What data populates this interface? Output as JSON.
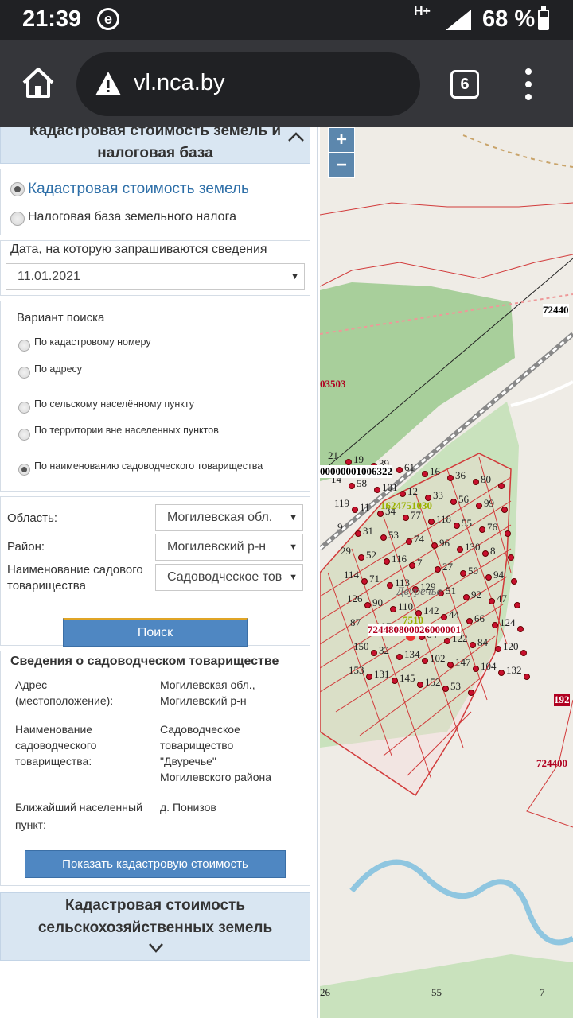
{
  "status_bar": {
    "time": "21:39",
    "app_badge": "e",
    "network": "H+",
    "battery_text": "68 %",
    "battery_level": 0.68
  },
  "browser": {
    "url": "vl.nca.by",
    "tab_count": "6"
  },
  "section1": {
    "title_line1": "Кадастровая стоимость земель и",
    "title_line2": "налоговая база"
  },
  "mode": {
    "option1": "Кадастровая стоимость земель",
    "option2": "Налоговая база земельного налога",
    "selected": 1
  },
  "date": {
    "label": "Дата, на которую запрашиваются сведения",
    "value": "11.01.2021"
  },
  "search_variant": {
    "title": "Вариант поиска",
    "options": [
      "По кадастровому номеру",
      "По адресу",
      "По сельскому населённому пункту",
      "По территории вне населенных пунктов",
      "По наименованию садоводческого товарищества"
    ],
    "selected": 5
  },
  "filters": {
    "region_label": "Область:",
    "region_value": "Могилевская обл.",
    "district_label": "Район:",
    "district_value": "Могилевский р-н",
    "garden_label_line1": "Наименование садового",
    "garden_label_line2": "товарищества",
    "garden_value": "Садоводческое тов"
  },
  "search_button": "Поиск",
  "info": {
    "title": "Сведения о садоводческом товариществе",
    "address_label_line1": "Адрес",
    "address_label_line2": "(местоположение):",
    "address_value_line1": "Могилевская обл.,",
    "address_value_line2": "Могилевский р-н",
    "name_label_line1": "Наименование",
    "name_label_line2": "садоводческого",
    "name_label_line3": "товарищества:",
    "name_value_line1": "Садоводческое",
    "name_value_line2": "товарищество",
    "name_value_line3": "\"Двуречье\"",
    "name_value_line4": "Могилевского района",
    "nearest_label_line1": "Ближайший населенный",
    "nearest_label_line2": "пункт:",
    "nearest_value": "д. Понизов",
    "show_button": "Показать кадастровую стоимость"
  },
  "section2": {
    "title_line1": "Кадастровая стоимость",
    "title_line2": "сельскохозяйственных земель"
  },
  "map": {
    "zoom_in": "+",
    "zoom_out": "−",
    "labels": {
      "l1": "72440",
      "l2": "03503",
      "l3": "00000001006322",
      "l4": "1624751030",
      "l5": "724480800026000001",
      "l6": "192",
      "l7": "724400",
      "l8": "Двуречье",
      "l9": "7510"
    },
    "plots": [
      "21",
      "19",
      "39",
      "61",
      "16",
      "36",
      "80",
      "14",
      "58",
      "101",
      "12",
      "33",
      "56",
      "99",
      "119",
      "11",
      "34",
      "77",
      "118",
      "55",
      "76",
      "9",
      "31",
      "53",
      "74",
      "96",
      "130",
      "8",
      "29",
      "52",
      "116",
      "7",
      "27",
      "50",
      "94",
      "114",
      "71",
      "113",
      "129",
      "51",
      "92",
      "47",
      "126",
      "90",
      "110",
      "142",
      "44",
      "66",
      "124",
      "87",
      "107",
      "140",
      "64",
      "122",
      "84",
      "120",
      "150",
      "32",
      "134",
      "102",
      "147",
      "104",
      "132",
      "153",
      "131",
      "145",
      "152",
      "53",
      "26",
      "55",
      "7"
    ]
  },
  "colors": {
    "accordion": "#d9e6f2",
    "button": "#4f87c2",
    "link": "#2e6fa8",
    "map_bg": "#efece6",
    "forest": "#a8cf9b",
    "plot_line": "#d23b3b",
    "dot": "#c8102e"
  }
}
